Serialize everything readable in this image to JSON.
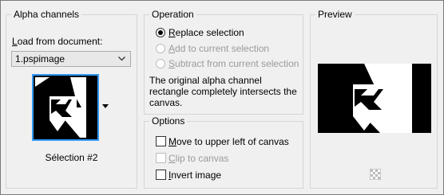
{
  "alpha": {
    "title": "Alpha channels",
    "load_label_prefix": "L",
    "load_label_rest": "oad from document:",
    "document_select": "1.pspimage",
    "selection_caption": "Sélection #2"
  },
  "operation": {
    "title": "Operation",
    "options": [
      {
        "u": "R",
        "rest": "eplace selection",
        "selected": true,
        "enabled": true
      },
      {
        "u": "A",
        "rest": "dd to current selection",
        "selected": false,
        "enabled": false
      },
      {
        "u": "S",
        "rest": "ubtract from current selection",
        "selected": false,
        "enabled": false
      }
    ],
    "message_line1": "The original alpha channel",
    "message_line2": "rectangle completely intersects the",
    "message_line3": "canvas."
  },
  "options": {
    "title": "Options",
    "move": {
      "u": "M",
      "rest": "ove to upper left of canvas",
      "checked": false,
      "enabled": true
    },
    "clip": {
      "u": "C",
      "rest": "lip to canvas",
      "checked": false,
      "enabled": false
    },
    "invert": {
      "u": "I",
      "rest": "nvert image",
      "checked": false,
      "enabled": true
    }
  },
  "preview": {
    "title": "Preview"
  },
  "colors": {
    "accent": "#3399ff",
    "panel": "#f0f0f0",
    "disabled_text": "#9a9a9a"
  },
  "icons": [
    "chevron-down-icon",
    "dropdown-arrow-icon",
    "transparency-grid-icon"
  ]
}
